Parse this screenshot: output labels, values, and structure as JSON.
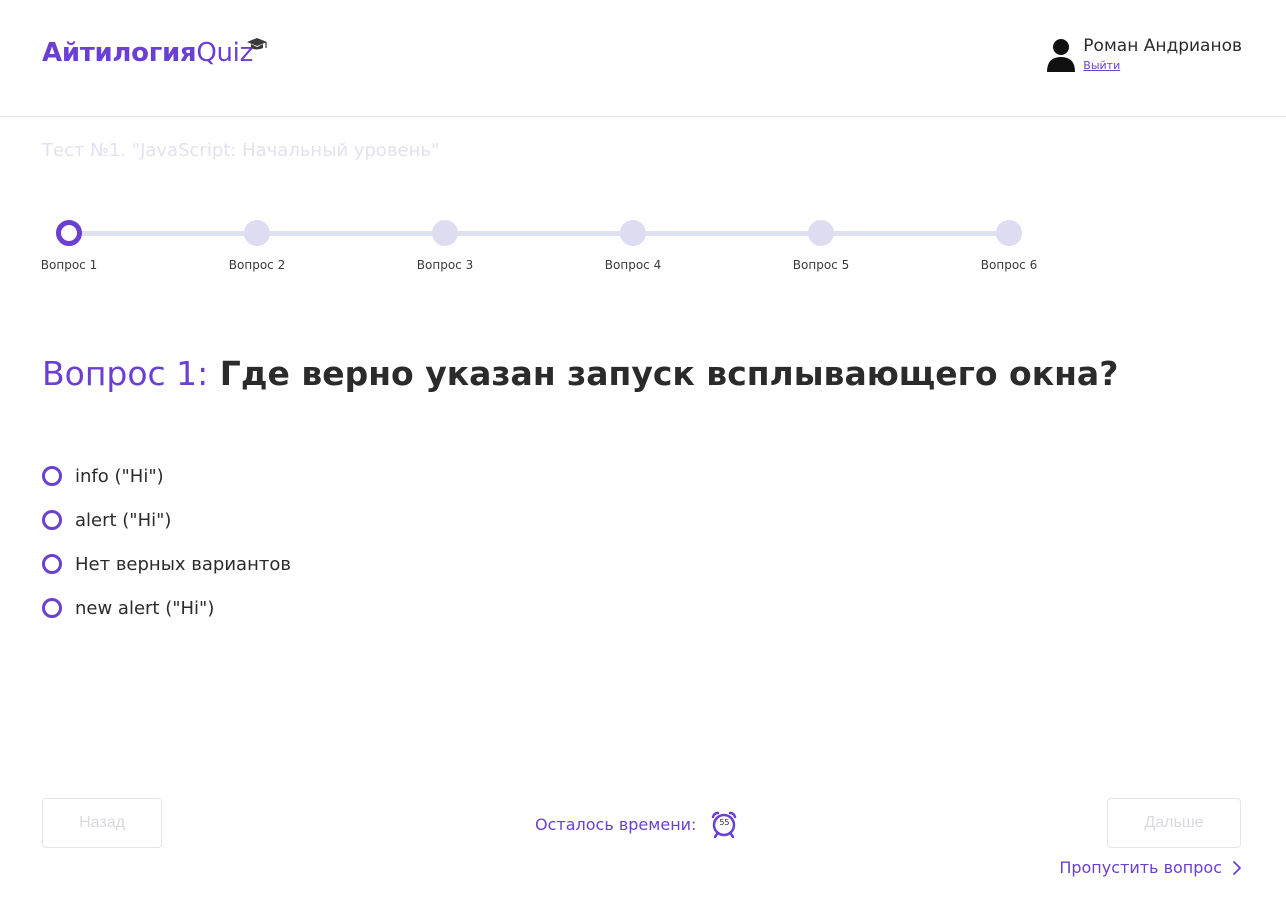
{
  "header": {
    "logo_main": "Айтилогия",
    "logo_quiz": "Quiz",
    "user_name": "Роман Андрианов",
    "logout_label": "Выйти"
  },
  "test": {
    "title": "Тест №1. \"JavaScript: Начальный уровень\""
  },
  "progress": {
    "current": 1,
    "steps": [
      "Вопрос 1",
      "Вопрос 2",
      "Вопрос 3",
      "Вопрос 4",
      "Вопрос 5",
      "Вопрос 6"
    ]
  },
  "question": {
    "number_label": "Вопрос 1:",
    "text": "Где верно указан запуск всплывающего окна?",
    "answers": [
      "info (\"Hi\")",
      "alert (\"Hi\")",
      "Нет верных вариантов",
      "new alert (\"Hi\")"
    ]
  },
  "footer": {
    "back_label": "Назад",
    "next_label": "Дальше",
    "timer_label": "Осталось времени:",
    "timer_value": "55",
    "skip_label": "Пропустить вопрос"
  },
  "colors": {
    "accent": "#6b3fd1",
    "inactive_step": "#dedcf1",
    "disabled_text": "#d9d9e0"
  },
  "icons": {
    "logo_badge": "graduation-cap-icon",
    "user": "user-icon",
    "timer": "alarm-clock-icon",
    "skip": "chevron-right-icon"
  }
}
